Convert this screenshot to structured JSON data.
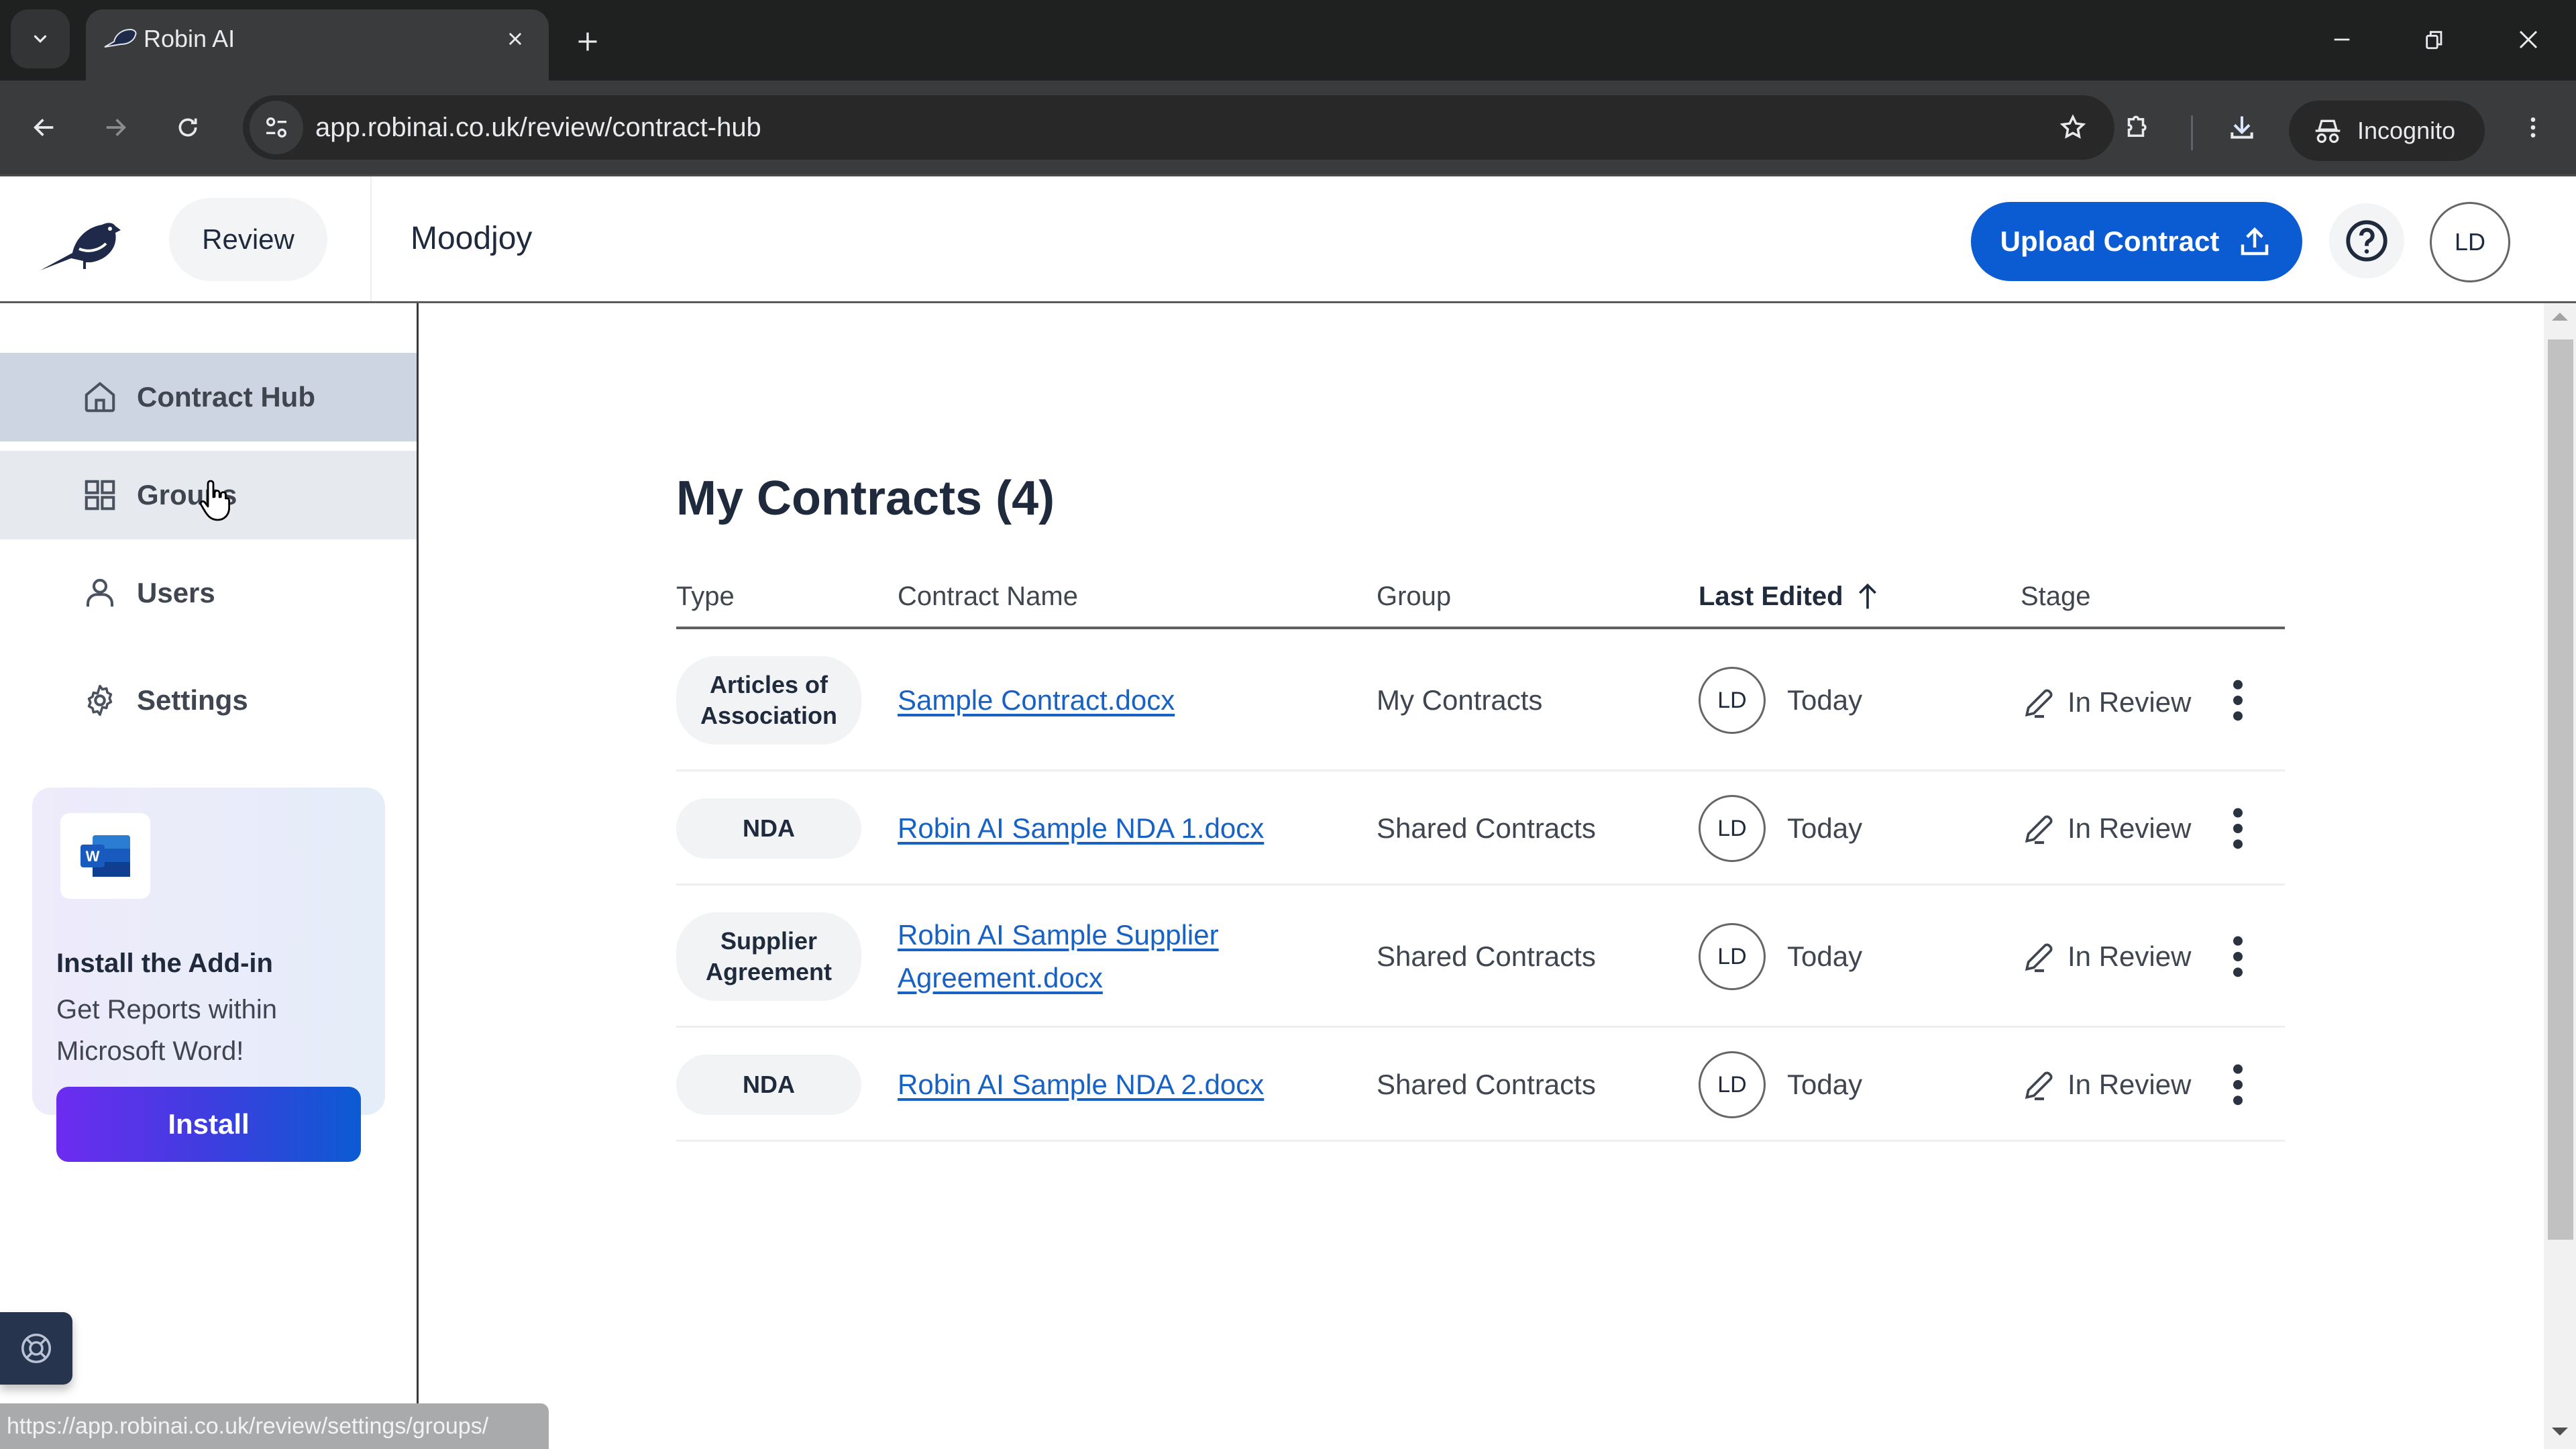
{
  "browser": {
    "tab_title": "Robin AI",
    "url": "app.robinai.co.uk/review/contract-hub",
    "incognito_label": "Incognito",
    "status_url": "https://app.robinai.co.uk/review/settings/groups/"
  },
  "header": {
    "product_label": "Review",
    "org_name": "Moodjoy",
    "upload_label": "Upload Contract",
    "user_initials": "LD",
    "accent_color": "#0b5bd3"
  },
  "sidebar": {
    "items": [
      {
        "label": "Contract Hub",
        "icon": "home-icon",
        "state": "active"
      },
      {
        "label": "Groups",
        "icon": "grid-icon",
        "state": "hover"
      },
      {
        "label": "Users",
        "icon": "user-icon",
        "state": "default"
      },
      {
        "label": "Settings",
        "icon": "gear-icon",
        "state": "default"
      }
    ],
    "addin": {
      "title": "Install the Add-in",
      "body": "Get Reports within Microsoft Word!",
      "button_label": "Install"
    }
  },
  "main": {
    "title": "My Contracts (4)",
    "columns": {
      "type": "Type",
      "name": "Contract Name",
      "group": "Group",
      "last_edited": "Last Edited",
      "stage": "Stage"
    },
    "sort": {
      "column": "Last Edited",
      "direction": "ascending"
    },
    "rows": [
      {
        "type": "Articles of Association",
        "name": "Sample Contract.docx",
        "group": "My Contracts",
        "editor": "LD",
        "last_edited": "Today",
        "stage": "In Review"
      },
      {
        "type": "NDA",
        "name": "Robin AI Sample NDA 1.docx",
        "group": "Shared Contracts",
        "editor": "LD",
        "last_edited": "Today",
        "stage": "In Review"
      },
      {
        "type": "Supplier Agreement",
        "name": "Robin AI Sample Supplier Agreement.docx",
        "group": "Shared Contracts",
        "editor": "LD",
        "last_edited": "Today",
        "stage": "In Review"
      },
      {
        "type": "NDA",
        "name": "Robin AI Sample NDA 2.docx",
        "group": "Shared Contracts",
        "editor": "LD",
        "last_edited": "Today",
        "stage": "In Review"
      }
    ]
  }
}
